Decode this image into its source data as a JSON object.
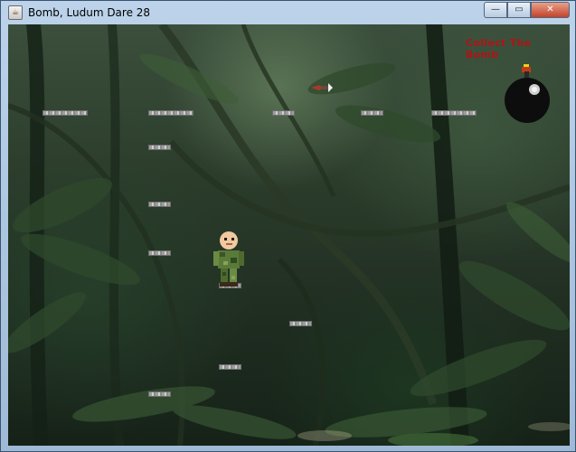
{
  "window": {
    "title": "Bomb, Ludum Dare 28",
    "minimize_glyph": "—",
    "maximize_glyph": "▭",
    "close_glyph": "✕"
  },
  "game": {
    "objective_text": "Collect The Bomb",
    "icons": {
      "app": "java-cup-icon",
      "bomb": "bomb-icon",
      "player": "soldier-sprite",
      "bird": "bird-sprite"
    },
    "colors": {
      "objective_text": "#b01414",
      "bomb_body": "#0d0d0d",
      "ledge": "#a8a8a8",
      "jungle_dark": "#1f2d21"
    }
  }
}
